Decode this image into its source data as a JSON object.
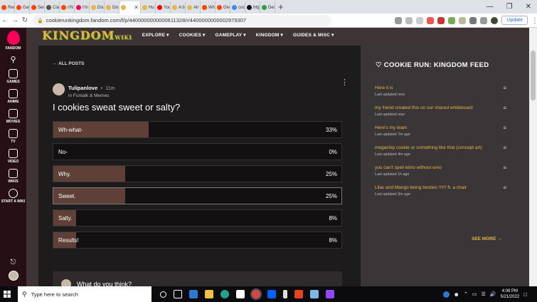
{
  "browser": {
    "tabs": [
      {
        "label": "Red",
        "color": "#ff4500"
      },
      {
        "label": "Gay",
        "color": "#ff4500"
      },
      {
        "label": "Sen",
        "color": "#ff4500"
      },
      {
        "label": "Cla",
        "color": "#555555"
      },
      {
        "label": "r/N",
        "color": "#ff4500"
      },
      {
        "label": "I'm",
        "color": "#fa005a"
      },
      {
        "label": "Dis",
        "color": "#e8b54a"
      },
      {
        "label": "Dis",
        "color": "#e8b54a"
      },
      {
        "label": "",
        "color": "#e8b54a",
        "active": true
      },
      {
        "label": "Hu",
        "color": "#e8b54a"
      },
      {
        "label": "You",
        "color": "#ff0000"
      },
      {
        "label": "A b",
        "color": "#e8b54a"
      },
      {
        "label": "Alr",
        "color": "#e8b54a"
      },
      {
        "label": "Wh",
        "color": "#ff4500"
      },
      {
        "label": "Giv",
        "color": "#ff4500"
      },
      {
        "label": "coo",
        "color": "#4285f4"
      },
      {
        "label": "http",
        "color": "#111111"
      },
      {
        "label": "Des",
        "color": "#2a9d4a"
      }
    ],
    "new_tab": "+",
    "url": "cookierunkingdom.fandom.com/f/p/4400000000000611328/r/4400000000002979307",
    "update_label": "Update"
  },
  "fandom_sidebar": {
    "brand": "FANDOM",
    "items": [
      {
        "label": "GAMES",
        "icon": "gamepad-icon"
      },
      {
        "label": "ANIME",
        "icon": "anime-icon"
      },
      {
        "label": "MOVIES",
        "icon": "movies-icon"
      },
      {
        "label": "TV",
        "icon": "tv-icon"
      },
      {
        "label": "VIDEO",
        "icon": "video-icon"
      },
      {
        "label": "WIKIS",
        "icon": "wikis-icon"
      },
      {
        "label": "START A WIKI",
        "icon": "plus-circle-icon"
      }
    ]
  },
  "wiki": {
    "logo": "KINGDOM",
    "logo_sub": "WIKI",
    "nav": [
      "EXPLORE",
      "COOKIES",
      "GAMEPLAY",
      "KINGDOM",
      "GUIDES & MISC"
    ]
  },
  "post": {
    "back_label": "ALL POSTS",
    "author": "Tulipanlove",
    "time": "11m",
    "category": "in Funtalk & Memes",
    "question": "I cookies sweat sweet or salty?",
    "options": [
      {
        "label": "Wh-what-",
        "percent": 33,
        "pct_label": "33%"
      },
      {
        "label": "No-",
        "percent": 0,
        "pct_label": "0%"
      },
      {
        "label": "Why.",
        "percent": 25,
        "pct_label": "25%"
      },
      {
        "label": "Sweet.",
        "percent": 25,
        "pct_label": "25%",
        "selected": true
      },
      {
        "label": "Salty.",
        "percent": 8,
        "pct_label": "8%"
      },
      {
        "label": "Results!",
        "percent": 8,
        "pct_label": "8%"
      }
    ],
    "reply_placeholder": "What do you think?"
  },
  "feed": {
    "title": "COOKIE RUN: KINGDOM FEED",
    "items": [
      {
        "title": "Here it is",
        "updated": "Last updated now"
      },
      {
        "title": "my friend created this on our shared whiteboard",
        "updated": "Last updated now"
      },
      {
        "title": "Here's my team",
        "updated": "Last updated 7m ago"
      },
      {
        "title": "megachip cookie or something like that (concept art)",
        "updated": "Last updated 4m ago"
      },
      {
        "title": "you can't spell elmo without emo",
        "updated": "Last updated 1h ago"
      },
      {
        "title": "Lilac and Mango being besties !!!!!! ft. a chair",
        "updated": "Last updated 3m ago"
      }
    ],
    "see_more": "SEE MORE"
  },
  "taskbar": {
    "search_placeholder": "Type here to search",
    "time": "4:06 PM",
    "date": "5/21/2022"
  },
  "colors": {
    "accent": "#e8b54a",
    "fandom_pink": "#fa005a",
    "poll_fill": "#5f4038"
  }
}
